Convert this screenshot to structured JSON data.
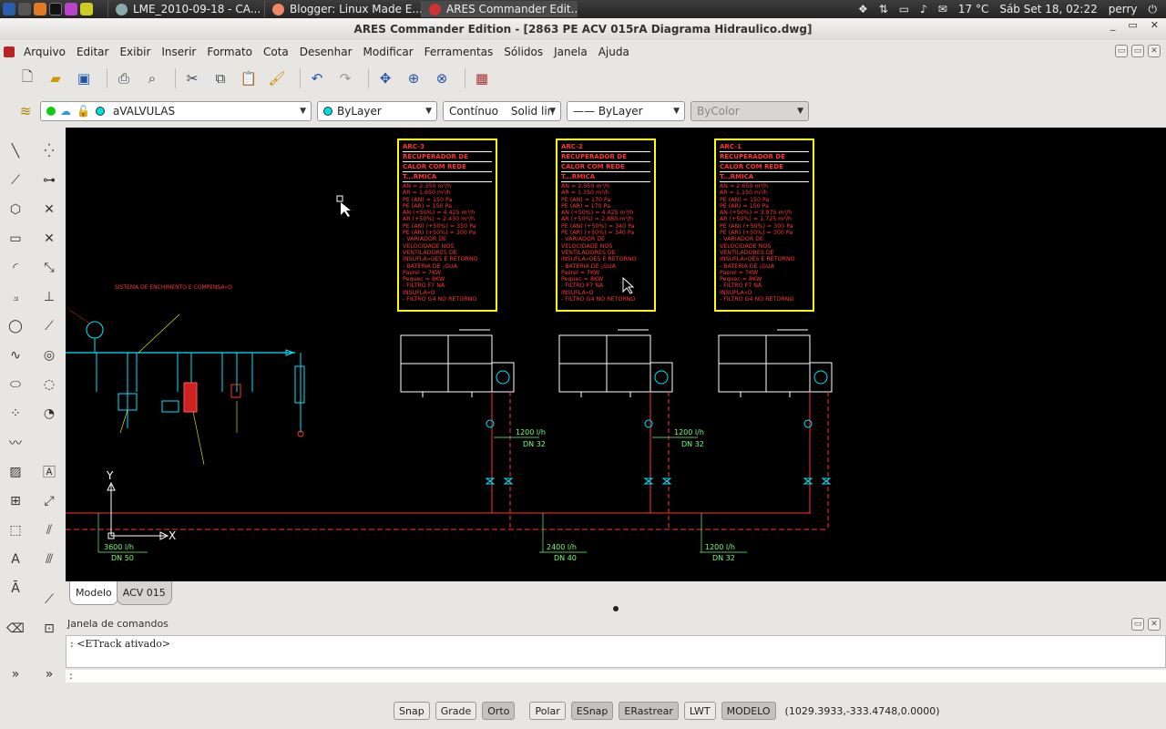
{
  "panel": {
    "tasks": [
      {
        "label": "LME_2010-09-18 - CA...",
        "color": "#8aa"
      },
      {
        "label": "Blogger: Linux Made E...",
        "color": "#e86"
      },
      {
        "label": "ARES Commander Edit...",
        "color": "#c33"
      }
    ],
    "temperature": "17 °C",
    "datetime": "Sáb Set 18, 02:22",
    "user": "perry"
  },
  "window": {
    "title": "ARES Commander Edition - [2863 PE ACV 015rA Diagrama Hidraulico.dwg]",
    "controls": [
      "_",
      "▭",
      "✕"
    ]
  },
  "menu": [
    "Arquivo",
    "Editar",
    "Exibir",
    "Inserir",
    "Formato",
    "Cota",
    "Desenhar",
    "Modificar",
    "Ferramentas",
    "Sólidos",
    "Janela",
    "Ajuda"
  ],
  "mdi_controls": [
    "▭",
    "▭",
    "✕"
  ],
  "toolbar": [
    "new-icon",
    "open-icon",
    "save-icon",
    "print-icon",
    "preview-icon",
    "cut-icon",
    "copy-icon",
    "paste-icon",
    "brush-icon",
    "undo-icon",
    "redo-icon",
    "pan-icon",
    "zoom-icon",
    "zoom-window-icon",
    "properties-icon"
  ],
  "props": {
    "layer": "aVALVULAS",
    "color": "ByLayer",
    "linetype_name": "Contínuo",
    "linetype_desc": "Solid lin",
    "lineweight": "—— ByLayer",
    "plotstyle": "ByColor"
  },
  "canvas": {
    "boxes": [
      {
        "head": [
          "ARC-3",
          "RECUPERADOR DE",
          "CALOR COM REDE",
          "T...RMICA"
        ],
        "lines": [
          "AN = 2.350 m³/h",
          "AR = 1.650 m³/h",
          "PE (AN) = 150 Pa",
          "PE (AR) = 150 Pa",
          "AN (+50%) = 4.425 m³/h",
          "AR (+50%) = 2.430 m³/h",
          "PE (AN) (+50%) = 350 Pa",
          "PE (AR) (+50%) = 300 Pa",
          "- VARIADOR DE",
          "VELOCIDADE NOS",
          "VENTILADORES DE",
          "INSUFLA»OES E RETORNO",
          "- BATERIA DE ¡GUA",
          "Pasrel = 7KW",
          "Pequec = 8KW",
          "- FILTRO F7 NA",
          "INSUFLA»O",
          "- FILTRO G4 NO RETORNO"
        ]
      },
      {
        "head": [
          "ARC-2",
          "RECUPERADOR DE",
          "CALOR COM REDE",
          "T...RMICA"
        ],
        "lines": [
          "AN = 2.950 m³/h",
          "AR = 1.350 m³/h",
          "PE (AN) = 170 Pa",
          "PE (AR) = 170 Pa",
          "AN (+50%) = 4.425 m³/h",
          "AR (+50%) = 2.880 m³/h",
          "PE (AN) (+50%) = 340 Pa",
          "PE (AR) (+50%) = 340 Pa",
          "- VARIADOR DE",
          "VELOCIDADE NOS",
          "VENTILADORES DE",
          "INSUFLA»OES E RETORNO",
          "- BATERIA DE ¡GUA",
          "Pasrel = 7KW",
          "Pequec = 8KW",
          "- FILTRO F7 NA",
          "INSUFLA»O",
          "- FILTRO G4 NO RETORNO"
        ]
      },
      {
        "head": [
          "ARC-1",
          "RECUPERADOR DE",
          "CALOR COM REDE",
          "T...RMICA"
        ],
        "lines": [
          "AN = 2.650 m³/h",
          "AR = 1.150 m³/h",
          "PE (AN) = 150 Pa",
          "PE (AR) = 150 Pa",
          "AN (+50%) = 3.975 m³/h",
          "AR (+50%) = 1.725 m³/h",
          "PE (AN) (+50%) = 300 Pa",
          "PE (AR) (+50%) = 300 Pa",
          "- VARIADOR DE",
          "VELOCIDADE NOS",
          "VENTILADORES DE",
          "INSUFLA»OES E RETORNO",
          "- BATERIA DE ¡GUA",
          "Pasrel = 7KW",
          "Pequec = 8KW",
          "- FILTRO F7 NA",
          "INSUFLA»O",
          "- FILTRO G4 NO RETORNO"
        ]
      }
    ],
    "system_title": "SISTEMA DE ENCHIMENTO E COMPENSA»O",
    "flows": [
      {
        "flow": "1200 l/h",
        "dn": "DN 32"
      },
      {
        "flow": "1200 l/h",
        "dn": "DN 32"
      },
      {
        "flow": "3600 l/h",
        "dn": "DN 50"
      },
      {
        "flow": "2400 l/h",
        "dn": "DN 40"
      },
      {
        "flow": "1200 l/h",
        "dn": "DN 32"
      }
    ],
    "ucs": {
      "x": "X",
      "y": "Y"
    }
  },
  "tabs": [
    "Modelo",
    "ACV 015"
  ],
  "command": {
    "title": "Janela de comandos",
    "history": ": <ETrack ativado>",
    "prompt": ":"
  },
  "status": {
    "buttons": [
      {
        "label": "Snap",
        "on": false
      },
      {
        "label": "Grade",
        "on": false
      },
      {
        "label": "Orto",
        "on": true
      },
      {
        "label": "Polar",
        "on": false
      },
      {
        "label": "ESnap",
        "on": true
      },
      {
        "label": "ERastrear",
        "on": true
      },
      {
        "label": "LWT",
        "on": false
      },
      {
        "label": "MODELO",
        "on": true
      }
    ],
    "coords": "(1029.3933,-333.4748,0.0000)"
  },
  "colors": {
    "canvas": "#000000",
    "cyan": "#00e5ff",
    "red": "#ff3333",
    "yellow": "#ffff00",
    "green": "#66ff66"
  }
}
